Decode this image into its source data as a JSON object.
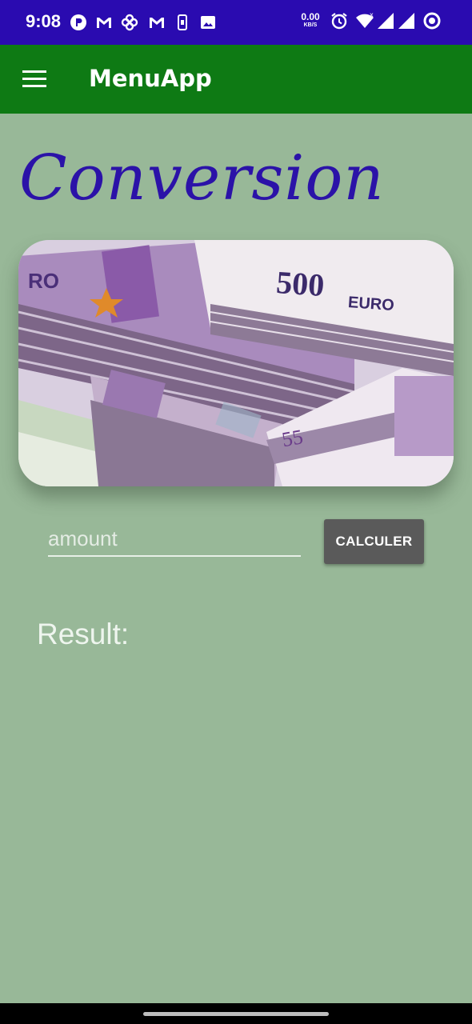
{
  "status_bar": {
    "time": "9:08",
    "net_speed": "0.00",
    "net_unit": "KB/S",
    "notification_icons": [
      "r-app-icon",
      "gmail-icon",
      "pinwheel-icon",
      "gmail-icon",
      "sim-icon",
      "image-icon"
    ],
    "system_icons": [
      "alarm-icon",
      "wifi-icon",
      "signal-icon",
      "signal-icon",
      "ring-icon"
    ]
  },
  "app_bar": {
    "title": "MenuApp",
    "menu_icon": "hamburger-menu-icon",
    "color": "#0e7a14"
  },
  "page": {
    "heading": "Conversion",
    "heading_color": "#2b12a8",
    "background": "#98b898",
    "image": {
      "subject": "euro-banknotes",
      "banknote_text": "500 EURO"
    }
  },
  "form": {
    "amount_placeholder": "amount",
    "amount_value": "",
    "calculate_label": "CALCULER"
  },
  "result": {
    "label": "Result:"
  }
}
